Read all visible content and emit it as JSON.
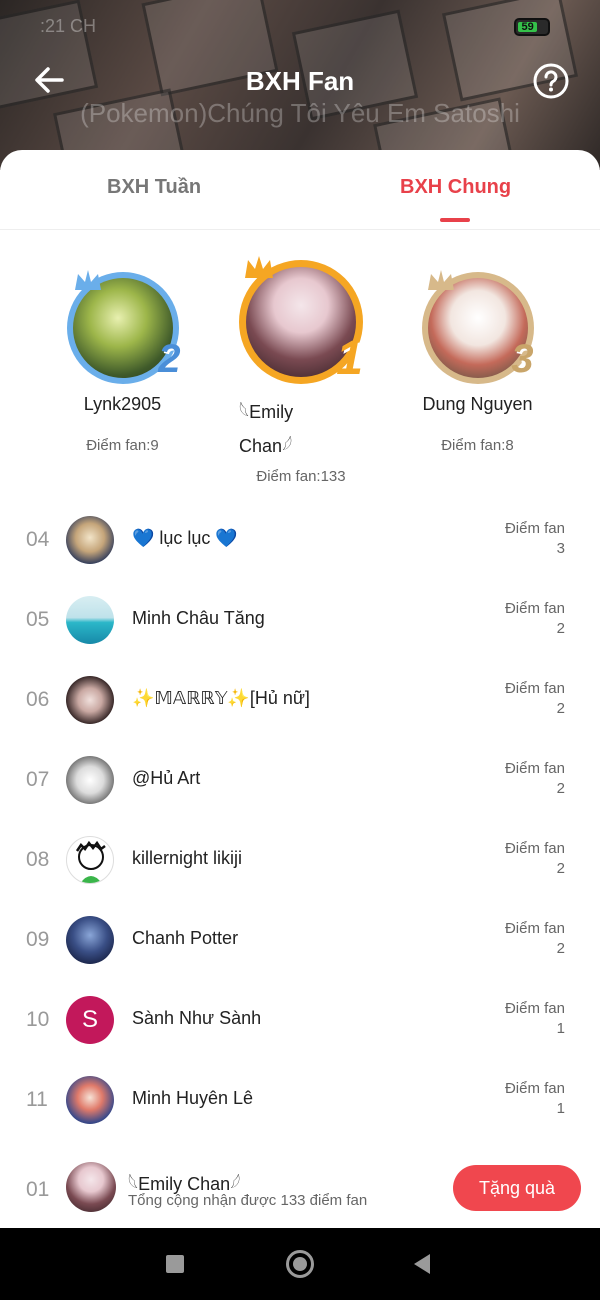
{
  "status_bar": {
    "time": ":21 CH",
    "battery_level": "59"
  },
  "header": {
    "title": "BXH Fan",
    "subtitle": "(Pokemon)Chúng Tôi Yêu Em Satoshi",
    "back_icon": "arrow-left-icon",
    "help_icon": "question-circle-icon"
  },
  "tabs": [
    {
      "label": "BXH Tuần",
      "active": false
    },
    {
      "label": "BXH Chung",
      "active": true
    }
  ],
  "colors": {
    "accent": "#e8414a",
    "silver": "#6aaeea",
    "gold": "#f5a623",
    "bronze": "#d7b98a"
  },
  "podium": {
    "first": {
      "rank": "1",
      "name_line1": "𓆩Emily",
      "name_line2": "Chan𓆪",
      "score": "Điểm fan:133"
    },
    "second": {
      "rank": "2",
      "name": "Lynk2905",
      "score": "Điểm fan:9"
    },
    "third": {
      "rank": "3",
      "name": "Dung Nguyen",
      "score": "Điểm fan:8"
    }
  },
  "list": {
    "score_label": "Điểm fan",
    "rows": [
      {
        "rank": "04",
        "name": "💙 lục lục 💙",
        "score": "3"
      },
      {
        "rank": "05",
        "name": "Minh Châu Tăng",
        "score": "2"
      },
      {
        "rank": "06",
        "name": "✨𝕄𝔸ℝℝ𝕐✨[Hủ nữ]",
        "score": "2"
      },
      {
        "rank": "07",
        "name": "@Hủ Art",
        "score": "2"
      },
      {
        "rank": "08",
        "name": "killernight likiji",
        "score": "2"
      },
      {
        "rank": "09",
        "name": "Chanh Potter",
        "score": "2"
      },
      {
        "rank": "10",
        "name": "Sành Như Sành",
        "score": "1",
        "avatar_letter": "S"
      },
      {
        "rank": "11",
        "name": "Minh Huyên Lê",
        "score": "1"
      }
    ]
  },
  "my_rank": {
    "rank": "01",
    "name": "𓆩Emily Chan𓆪",
    "total": "Tổng cộng nhận được 133 điểm fan",
    "gift_button": "Tặng quà"
  },
  "navbar": {
    "recent_icon": "square-icon",
    "home_icon": "circle-home-icon",
    "back_icon": "triangle-back-icon"
  }
}
